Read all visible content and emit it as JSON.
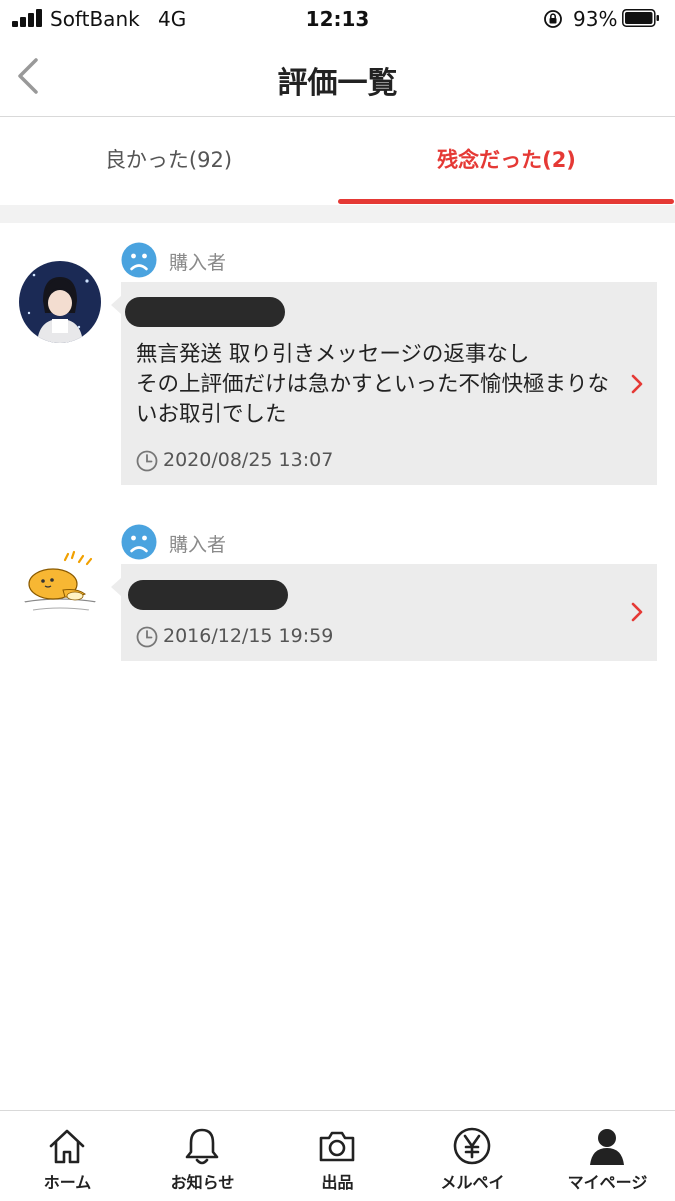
{
  "status_bar": {
    "carrier": "SoftBank",
    "network": "4G",
    "time": "12:13",
    "battery_percent": "93%"
  },
  "nav": {
    "title": "評価一覧"
  },
  "tabs": [
    {
      "label": "良かった(92)",
      "active": false
    },
    {
      "label": "残念だった(2)",
      "active": true
    }
  ],
  "reviews": [
    {
      "role": "購入者",
      "comment": "無言発送 取り引きメッセージの返事なし\nその上評価だけは急かすといった不愉快極まりないお取引でした",
      "date": "2020/08/25 13:07",
      "rating_icon": "sad-face-icon"
    },
    {
      "role": "購入者",
      "comment": "",
      "date": "2016/12/15 19:59",
      "rating_icon": "sad-face-icon"
    }
  ],
  "tabbar": [
    {
      "label": "ホーム",
      "icon": "home-icon"
    },
    {
      "label": "お知らせ",
      "icon": "bell-icon"
    },
    {
      "label": "出品",
      "icon": "camera-icon"
    },
    {
      "label": "メルペイ",
      "icon": "yen-icon"
    },
    {
      "label": "マイページ",
      "icon": "person-icon"
    }
  ],
  "colors": {
    "accent": "#e53935",
    "sad_icon": "#4aa3df",
    "bubble_bg": "#ececec"
  }
}
